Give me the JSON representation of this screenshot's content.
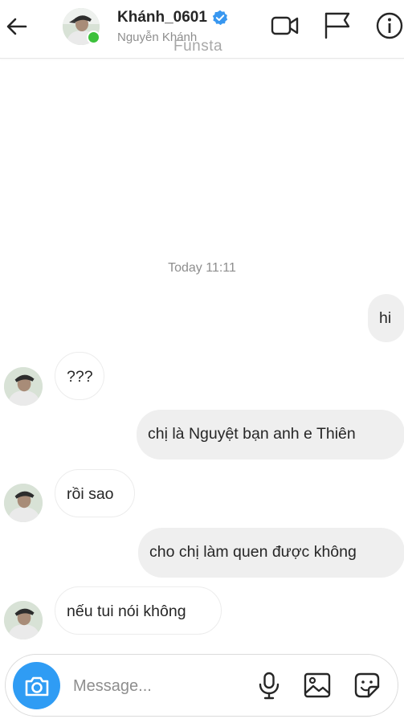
{
  "header": {
    "username": "Khánh_0601",
    "fullname": "Nguyễn Khánh",
    "watermark": "Funsta",
    "verified": true,
    "online": true
  },
  "thread": {
    "timestamp": "Today 11:11",
    "messages": [
      {
        "from": "me",
        "text": "hi"
      },
      {
        "from": "them",
        "text": "???"
      },
      {
        "from": "me",
        "text": "chị là Nguyệt bạn anh e Thiên"
      },
      {
        "from": "them",
        "text": "rồi sao"
      },
      {
        "from": "me",
        "text": "cho chị làm quen được không"
      },
      {
        "from": "them",
        "text": "nếu tui nói không"
      }
    ]
  },
  "composer": {
    "placeholder": "Message...",
    "value": ""
  },
  "icons": {
    "back": "arrow-left-icon",
    "video": "video-call-icon",
    "flag": "flag-icon",
    "info": "info-icon",
    "camera": "camera-icon",
    "mic": "microphone-icon",
    "gallery": "gallery-icon",
    "sticker": "sticker-icon"
  },
  "colors": {
    "verified_blue": "#3897f0",
    "online_green": "#3cc13b",
    "camera_blue": "#2f9cf4",
    "outgoing_bubble": "#efefef",
    "muted_text": "#8e8e8e"
  }
}
